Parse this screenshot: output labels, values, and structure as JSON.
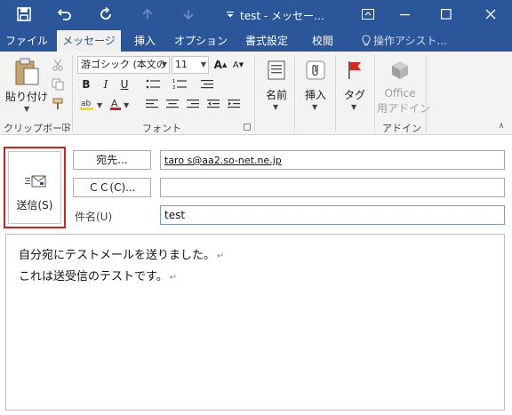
{
  "window": {
    "title": "test - メッセー…",
    "colors": {
      "title_bar": "#2b579a",
      "send_highlight": "#d21f1f"
    }
  },
  "tabs": [
    {
      "label": "ファイル"
    },
    {
      "label": "メッセージ"
    },
    {
      "label": "挿入"
    },
    {
      "label": "オプション"
    },
    {
      "label": "書式設定"
    },
    {
      "label": "校閲"
    },
    {
      "label": "操作アシスト..."
    }
  ],
  "ribbon": {
    "clipboard": {
      "paste": "貼り付け",
      "group": "クリップボード"
    },
    "font": {
      "font_name": "游ゴシック (本文の",
      "font_size": "11",
      "group": "フォント"
    },
    "names": {
      "label": "名前"
    },
    "insert": {
      "label": "挿入"
    },
    "tags": {
      "label": "タグ"
    },
    "addins": {
      "office_line1": "Office",
      "office_line2": "用アドイン",
      "group": "アドイン"
    }
  },
  "compose": {
    "send_label": "送信(S)",
    "to_button": "宛先...",
    "cc_button": "ＣＣ(C)...",
    "to_value": "taro s@aa2.so-net.ne.jp",
    "cc_value": "",
    "subject_label": "件名(U)",
    "subject_value": "test",
    "body_lines": [
      "自分宛にテストメールを送りました。",
      "これは送受信のテストです。"
    ],
    "paragraph_mark": "↵"
  }
}
